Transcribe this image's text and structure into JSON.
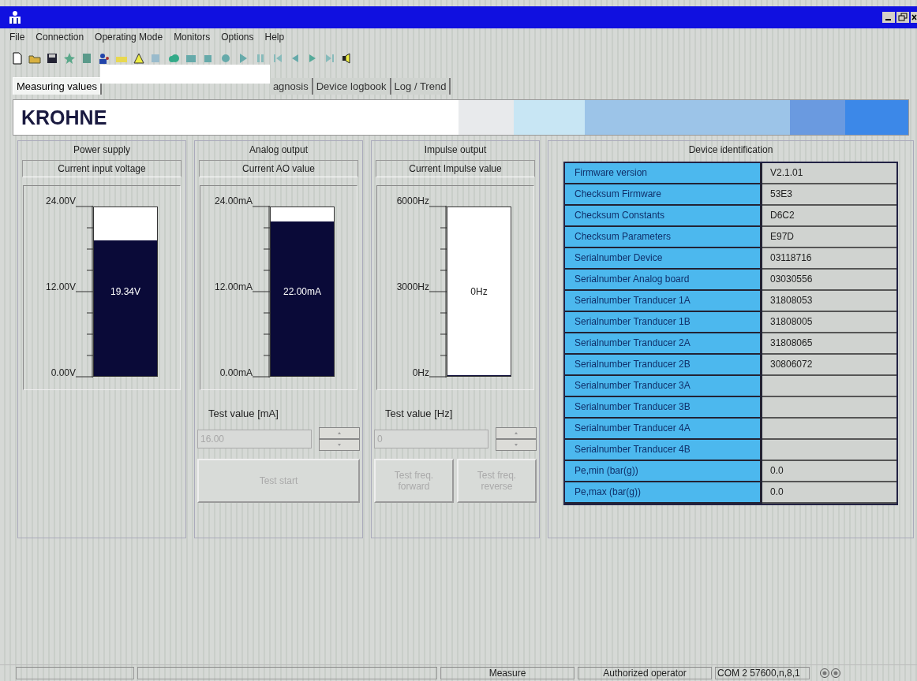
{
  "menu": [
    "File",
    "Connection",
    "Operating Mode",
    "Monitors",
    "Options",
    "Help"
  ],
  "tabs": [
    {
      "label": "Measuring values",
      "selected": true
    },
    {
      "label": "agnosis",
      "selected": false
    },
    {
      "label": "Device logbook",
      "selected": false
    },
    {
      "label": "Log / Trend",
      "selected": false
    }
  ],
  "banner": {
    "brand": "KROHNE"
  },
  "panels": [
    {
      "title": "Power supply",
      "subtitle": "Current input voltage",
      "ticks": [
        "24.00V",
        "12.00V",
        "0.00V"
      ],
      "reading": "19.34V",
      "level": 0.806
    },
    {
      "title": "Analog output",
      "subtitle": "Current AO value",
      "ticks": [
        "24.00mA",
        "12.00mA",
        "0.00mA"
      ],
      "reading": "22.00mA",
      "level": 0.917,
      "test": {
        "label": "Test value [mA]",
        "value": "16.00",
        "disabled": true,
        "buttons": [
          "Test start"
        ]
      }
    },
    {
      "title": "Impulse output",
      "subtitle": "Current Impulse value",
      "ticks": [
        "6000Hz",
        "3000Hz",
        "0Hz"
      ],
      "reading": "0Hz",
      "level": 0,
      "test": {
        "label": "Test value [Hz]",
        "value": "0",
        "disabled": true,
        "buttons": [
          "Test freq. forward",
          "Test freq. reverse"
        ]
      }
    }
  ],
  "device": {
    "title": "Device identification",
    "rows": [
      {
        "label": "Firmware version",
        "value": "V2.1.01"
      },
      {
        "label": "Checksum Firmware",
        "value": "53E3"
      },
      {
        "label": "Checksum Constants",
        "value": "D6C2"
      },
      {
        "label": "Checksum Parameters",
        "value": "E97D"
      },
      {
        "label": "Serialnumber Device",
        "value": "03118716"
      },
      {
        "label": "Serialnumber Analog board",
        "value": "03030556"
      },
      {
        "label": "Serialnumber Tranducer 1A",
        "value": "31808053"
      },
      {
        "label": "Serialnumber Tranducer 1B",
        "value": "31808005"
      },
      {
        "label": "Serialnumber Tranducer 2A",
        "value": "31808065"
      },
      {
        "label": "Serialnumber Tranducer 2B",
        "value": "30806072"
      },
      {
        "label": "Serialnumber Tranducer 3A",
        "value": ""
      },
      {
        "label": "Serialnumber Tranducer 3B",
        "value": ""
      },
      {
        "label": "Serialnumber Tranducer 4A",
        "value": ""
      },
      {
        "label": "Serialnumber Tranducer 4B",
        "value": ""
      },
      {
        "label": "Pe,min (bar(g))",
        "value": "0.0"
      },
      {
        "label": "Pe,max (bar(g))",
        "value": "0.0"
      }
    ]
  },
  "status_bar": [
    "Measure",
    "Authorized operator",
    "COM 2  57600,n,8,1"
  ]
}
